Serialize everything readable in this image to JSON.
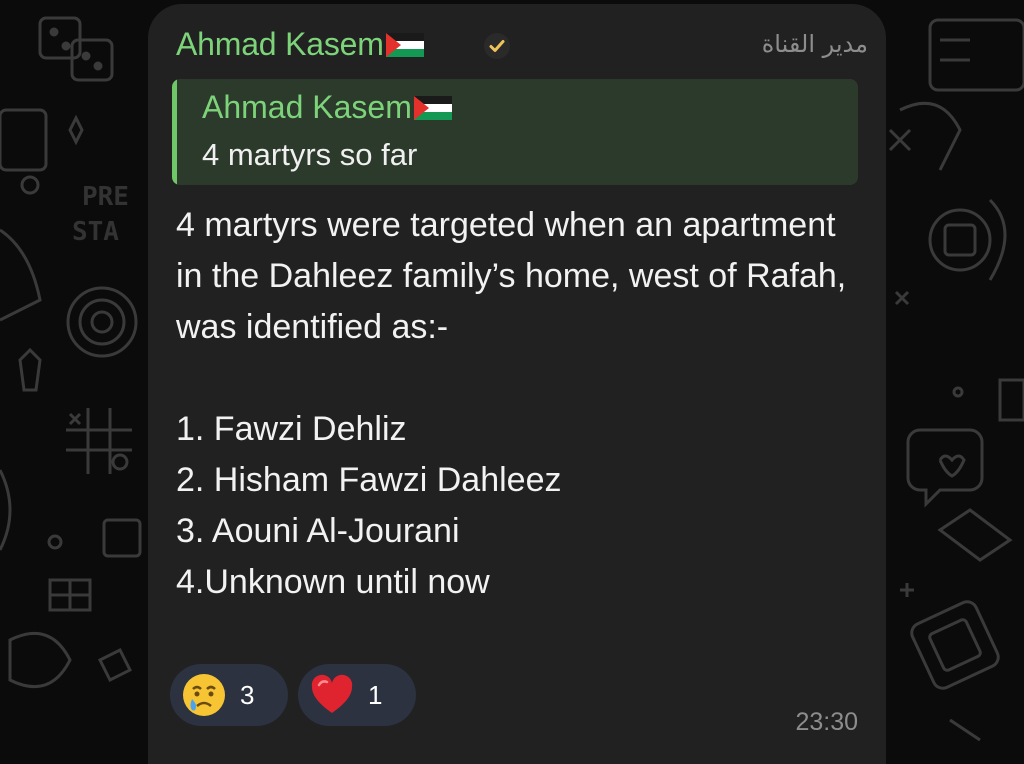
{
  "message": {
    "sender": "Ahmad Kasem",
    "sender_flag": "palestine-flag",
    "role": "مدير القناة",
    "reply": {
      "sender": "Ahmad Kasem",
      "text": "4 martyrs so far"
    },
    "body": "4 martyrs were targeted when an apartment in the Dahleez family’s home, west of Rafah, was identified as:-\n\n1. Fawzi Dehliz\n2. Hisham Fawzi Dahleez\n3. Aouni Al-Jourani\n4.Unknown until now",
    "reactions": [
      {
        "emoji": "crying-face",
        "count": "3"
      },
      {
        "emoji": "red-heart",
        "count": "1"
      }
    ],
    "time": "23:30"
  },
  "colors": {
    "background": "#0b0b0b",
    "bubble": "#212121",
    "name_green": "#7dd37a",
    "reply_bg": "#2c3a2b",
    "reaction_chip": "#2c3240"
  }
}
